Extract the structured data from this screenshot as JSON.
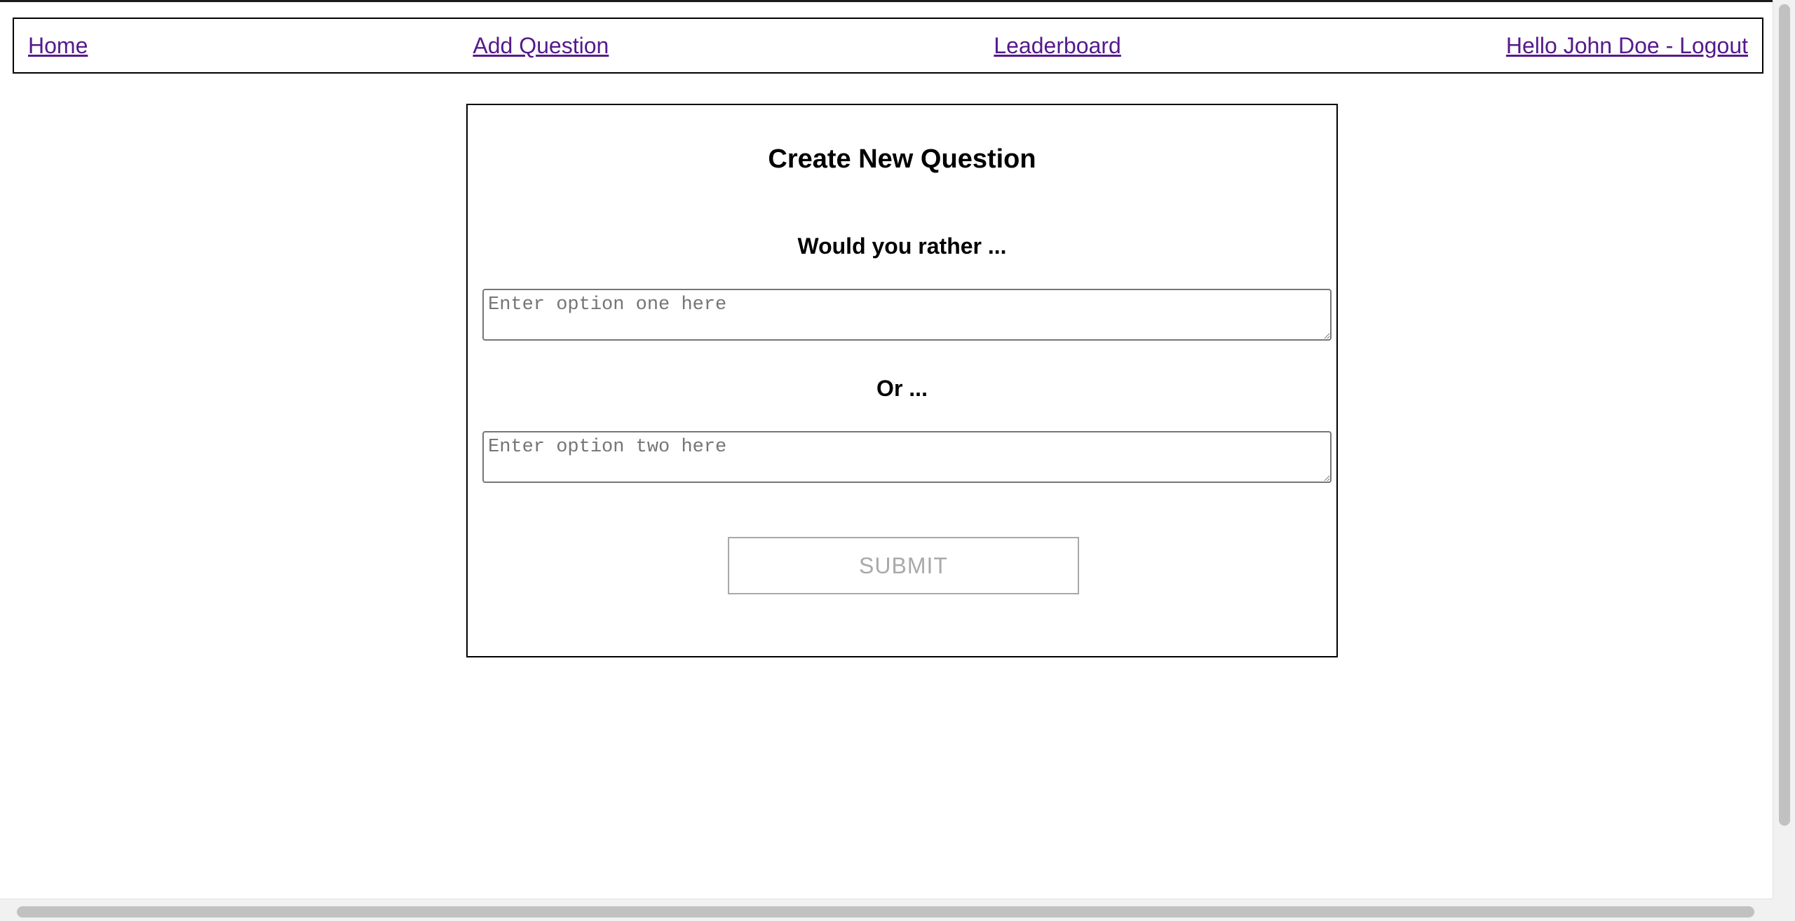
{
  "nav": {
    "home": "Home",
    "add_question": "Add Question",
    "leaderboard": "Leaderboard",
    "user_logout": "Hello John Doe - Logout"
  },
  "form": {
    "title": "Create New Question",
    "prompt_one": "Would you rather ...",
    "option_one_placeholder": "Enter option one here",
    "prompt_two": "Or ...",
    "option_two_placeholder": "Enter option two here",
    "submit_label": "SUBMIT"
  },
  "colors": {
    "link": "#551a8b",
    "disabled_text": "#a9a9a9"
  }
}
